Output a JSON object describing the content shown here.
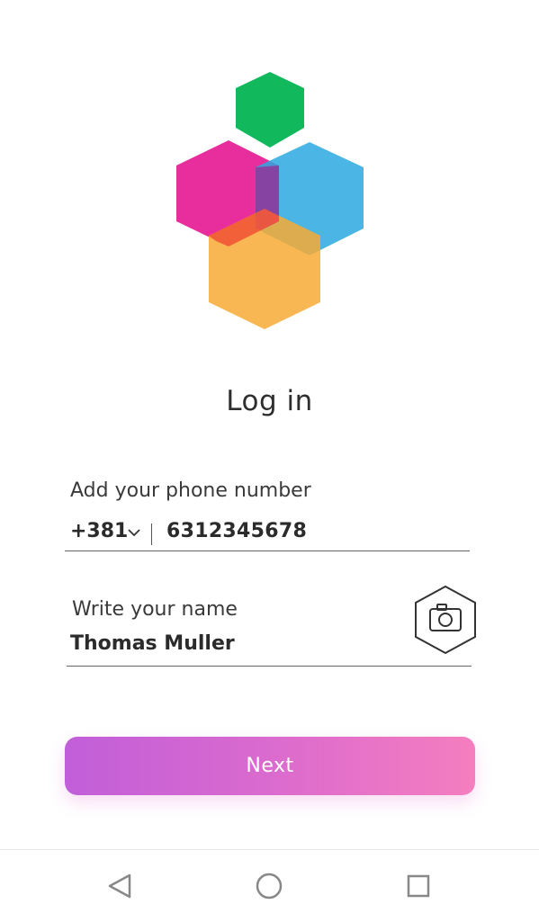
{
  "app": {
    "title": "Log in",
    "logo_icon": "hexagon-cluster-logo",
    "colors": {
      "green": "#12b85c",
      "magenta": "#e8299a",
      "blue": "#2ba9e0",
      "orange": "#f7aa35",
      "button_gradient_start": "#c15ed9",
      "button_gradient_end": "#f57ebf"
    }
  },
  "form": {
    "phone_label": "Add your phone number",
    "country_code": "+381",
    "phone_value": "6312345678",
    "name_label": "Write your name",
    "name_value": "Thomas Muller",
    "camera_icon": "camera-icon"
  },
  "actions": {
    "next_label": "Next"
  },
  "navbar": {
    "back_icon": "back-triangle-icon",
    "home_icon": "home-circle-icon",
    "recent_icon": "recent-square-icon"
  }
}
